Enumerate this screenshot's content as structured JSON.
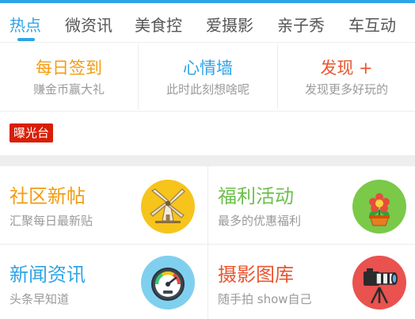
{
  "tabs": [
    {
      "label": "热点",
      "active": true
    },
    {
      "label": "微资讯",
      "active": false
    },
    {
      "label": "美食控",
      "active": false
    },
    {
      "label": "爱摄影",
      "active": false
    },
    {
      "label": "亲子秀",
      "active": false
    },
    {
      "label": "车互动",
      "active": false
    }
  ],
  "quick_links": [
    {
      "title": "每日签到",
      "subtitle": "赚金币赢大礼",
      "color": "#f39c12"
    },
    {
      "title": "心情墙",
      "subtitle": "此时此刻想啥呢",
      "color": "#2fa4e7"
    },
    {
      "title": "发现 +",
      "subtitle": "发现更多好玩的",
      "color": "#e8552f"
    }
  ],
  "badge": {
    "label": "曝光台",
    "color": "#d81e06"
  },
  "grid": [
    {
      "title": "社区新帖",
      "subtitle": "汇聚每日最新贴",
      "title_color": "#f39c12",
      "icon": "windmill-icon",
      "icon_bg": "#f6c41b"
    },
    {
      "title": "福利活动",
      "subtitle": "最多的优惠福利",
      "title_color": "#6cc04a",
      "icon": "flower-pot-icon",
      "icon_bg": "#7bc948"
    },
    {
      "title": "新闻资讯",
      "subtitle": "头条早知道",
      "title_color": "#2fa4e7",
      "icon": "gauge-icon",
      "icon_bg": "#7fd0ee"
    },
    {
      "title": "摄影图库",
      "subtitle": "随手拍 show自己",
      "title_color": "#e8552f",
      "icon": "camera-tripod-icon",
      "icon_bg": "#e9524f"
    }
  ],
  "colors": {
    "accent": "#2fa4e7",
    "divider": "#eeeeee"
  }
}
